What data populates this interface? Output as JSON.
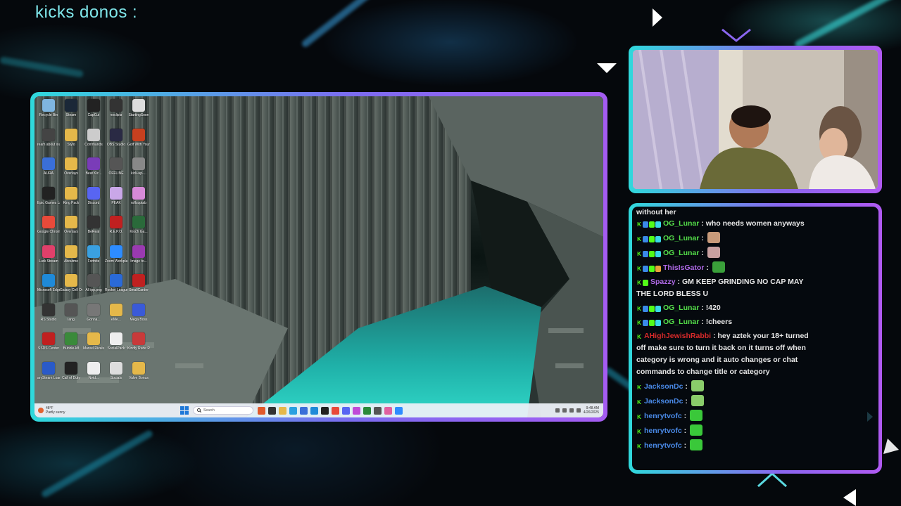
{
  "overlay": {
    "donos_label": "kicks donos :",
    "accent_cyan": "#2fd9dc",
    "accent_purple": "#a55cf2"
  },
  "desktop": {
    "icons": [
      {
        "label": "Recycle Bin",
        "color": "#7fb6e0"
      },
      {
        "label": "Steam",
        "color": "#1b2838"
      },
      {
        "label": "CapCut",
        "color": "#222"
      },
      {
        "label": "noclipia",
        "color": "#333"
      },
      {
        "label": "StartingSoon",
        "color": "#ddd"
      },
      {
        "label": "ream about ious pictu...",
        "color": "#444"
      },
      {
        "label": "Stylo",
        "color": "#e5b84a"
      },
      {
        "label": "Commands",
        "color": "#ccc"
      },
      {
        "label": "OBS Studio",
        "color": "#2a2a44"
      },
      {
        "label": "Golf With Your Friends",
        "color": "#c8401f"
      },
      {
        "label": "AURA",
        "color": "#3a6fd8"
      },
      {
        "label": "Overlays",
        "color": "#e5b84a"
      },
      {
        "label": "Beat Kic...",
        "color": "#7a3cb8"
      },
      {
        "label": "OFFLINE",
        "color": "#555"
      },
      {
        "label": "kick-up-...",
        "color": "#888"
      },
      {
        "label": "Epic Games Launcher",
        "color": "#222"
      },
      {
        "label": "King Pack",
        "color": "#e5b84a"
      },
      {
        "label": "Discord",
        "color": "#5865f2"
      },
      {
        "label": "PEAK",
        "color": "#c9a7e8"
      },
      {
        "label": "roflcoptab",
        "color": "#d78ad8"
      },
      {
        "label": "Google Chrome",
        "color": "#e84a3a"
      },
      {
        "label": "Overlays",
        "color": "#e5b84a"
      },
      {
        "label": "BeReal",
        "color": "#333"
      },
      {
        "label": "R.E.P.O.",
        "color": "#c02020"
      },
      {
        "label": "Kroch Ga...",
        "color": "#2a6a3a"
      },
      {
        "label": "Lurk Stream",
        "color": "#e0406a"
      },
      {
        "label": "Aboutme",
        "color": "#e5b84a"
      },
      {
        "label": "Fortnite",
        "color": "#3aa0e0"
      },
      {
        "label": "Zoom Workplace",
        "color": "#2d8cff"
      },
      {
        "label": "Image to...",
        "color": "#9a3ab0"
      },
      {
        "label": "Microsoft Edge",
        "color": "#1f8ad8"
      },
      {
        "label": "Galaxy Cell Overlays",
        "color": "#e5b84a"
      },
      {
        "label": "All ipp.png",
        "color": "#555"
      },
      {
        "label": "Rocket League",
        "color": "#2a6ad8"
      },
      {
        "label": "SmallCarder",
        "color": "#c02020"
      },
      {
        "label": "RS Studio",
        "color": "#333"
      },
      {
        "label": "lang",
        "color": "#555"
      },
      {
        "label": "Gonna...",
        "color": "#777"
      },
      {
        "label": "eMe...",
        "color": "#e5b84a"
      },
      {
        "label": "Mega Boss",
        "color": "#3a5ad8"
      },
      {
        "label": "SSDS Center",
        "color": "#c02020"
      },
      {
        "label": "Bubble-k8",
        "color": "#3a8a3a"
      },
      {
        "label": "Marvel Rivals",
        "color": "#e5b84a"
      },
      {
        "label": "SocialPack",
        "color": "#eee"
      },
      {
        "label": "Kindly Rude Remix",
        "color": "#c83a3a"
      },
      {
        "label": "arySteam Loadcast",
        "color": "#2a5ac8"
      },
      {
        "label": "Call of Duty",
        "color": "#222"
      },
      {
        "label": "Nvid...",
        "color": "#eee"
      },
      {
        "label": "Socials",
        "color": "#ddd"
      },
      {
        "label": "Valve Bonus",
        "color": "#e5b84a"
      }
    ],
    "taskbar": {
      "weather_temp": "48°F",
      "weather_desc": "Partly sunny",
      "search_placeholder": "Search",
      "clock_time": "9:48 AM",
      "clock_date": "4/26/2025",
      "apps": [
        "#e05a2a",
        "#333",
        "#e5b84a",
        "#2aa0e0",
        "#3a6fd8",
        "#1f8ad8",
        "#222",
        "#e84a3a",
        "#5865f2",
        "#c04ad8",
        "#2a8a3a",
        "#555",
        "#e060a0",
        "#2d8cff"
      ]
    }
  },
  "chat": {
    "partial_top": "without her",
    "messages": [
      {
        "user": "OG_Lunar",
        "color": "#55e04a",
        "badges": [
          "k",
          "s",
          "v",
          "b"
        ],
        "text": "who needs women anyways"
      },
      {
        "user": "OG_Lunar",
        "color": "#55e04a",
        "badges": [
          "k",
          "s",
          "v",
          "b"
        ],
        "emote": "#c89a7a"
      },
      {
        "user": "OG_Lunar",
        "color": "#55e04a",
        "badges": [
          "k",
          "s",
          "v",
          "b"
        ],
        "emote": "#c8a0a0"
      },
      {
        "user": "ThisIsGator",
        "color": "#b06ae8",
        "badges": [
          "k",
          "s",
          "v",
          "g"
        ],
        "emote": "#3aa03a"
      },
      {
        "user": "Spazzy",
        "color": "#b06ae8",
        "badges": [
          "k",
          "v"
        ],
        "text": "GM KEEP GRINDING NO CAP MAY THE LORD BLESS U"
      },
      {
        "user": "OG_Lunar",
        "color": "#55e04a",
        "badges": [
          "k",
          "s",
          "v",
          "b"
        ],
        "text": "!420"
      },
      {
        "user": "OG_Lunar",
        "color": "#55e04a",
        "badges": [
          "k",
          "s",
          "v",
          "b"
        ],
        "text": "!cheers"
      },
      {
        "user": "AHighJewishRabbi",
        "color": "#d82a2a",
        "badges": [
          "k"
        ],
        "text": "hey aztek your 18+ turned off make sure to turn it back on it turns off when category is wrong and it auto changes or chat commands to change title or category"
      },
      {
        "user": "JacksonDc",
        "color": "#4a8ae8",
        "badges": [
          "k"
        ],
        "emote": "#8acc6a"
      },
      {
        "user": "JacksonDc",
        "color": "#4a8ae8",
        "badges": [
          "k"
        ],
        "emote": "#8acc6a"
      },
      {
        "user": "henrytvofc",
        "color": "#4a8ae8",
        "badges": [
          "k"
        ],
        "emote": "#3ac83a"
      },
      {
        "user": "henrytvofc",
        "color": "#4a8ae8",
        "badges": [
          "k"
        ],
        "emote": "#3ac83a"
      },
      {
        "user": "henrytvofc",
        "color": "#4a8ae8",
        "badges": [
          "k"
        ],
        "emote": "#3ac83a"
      }
    ]
  }
}
